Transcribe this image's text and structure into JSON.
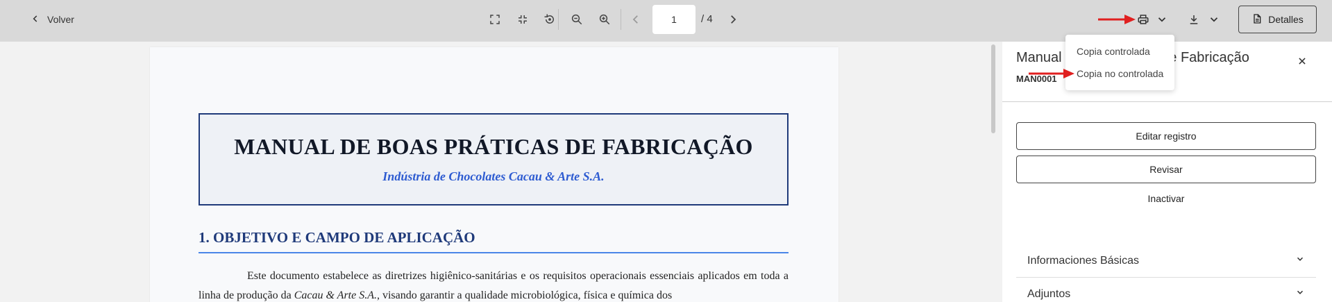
{
  "toolbar": {
    "back_label": "Volver",
    "page_current": "1",
    "page_total": "/ 4",
    "details_label": "Detalles",
    "icons": [
      "fullscreen-icon",
      "fit-page-icon",
      "rotate-icon",
      "zoom-out-icon",
      "zoom-in-icon",
      "prev-page-icon",
      "next-page-icon",
      "print-icon",
      "chevron-down-icon",
      "download-icon",
      "document-icon"
    ]
  },
  "print_menu": {
    "items": [
      "Copia controlada",
      "Copia no controlada"
    ]
  },
  "document": {
    "title": "MANUAL DE BOAS PRÁTICAS DE FABRICAÇÃO",
    "subtitle": "Indústria de Chocolates Cacau & Arte S.A.",
    "section_heading": "1. OBJETIVO E CAMPO DE APLICAÇÃO",
    "paragraph_start": "Este documento estabelece as diretrizes higiênico-sanitárias e os requisitos operacionais essenciais aplicados em toda a linha de produção da ",
    "paragraph_company": "Cacau & Arte S.A.",
    "paragraph_end": ", visando garantir a qualidade microbiológica, física e química dos"
  },
  "side_panel": {
    "title_part1": "Manual",
    "title_part2": "s de Fabricação",
    "code": "MAN0001",
    "edit_label": "Editar registro",
    "review_label": "Revisar",
    "inactivate_label": "Inactivar",
    "accordions": [
      "Informaciones Básicas",
      "Adjuntos"
    ]
  },
  "colors": {
    "toolbar_bg": "#d9d9d9",
    "title_border": "#1f3a7a",
    "subtitle": "#2d5bd1",
    "heading_rule": "#4a86e8",
    "annotation_arrow": "#e02020"
  }
}
